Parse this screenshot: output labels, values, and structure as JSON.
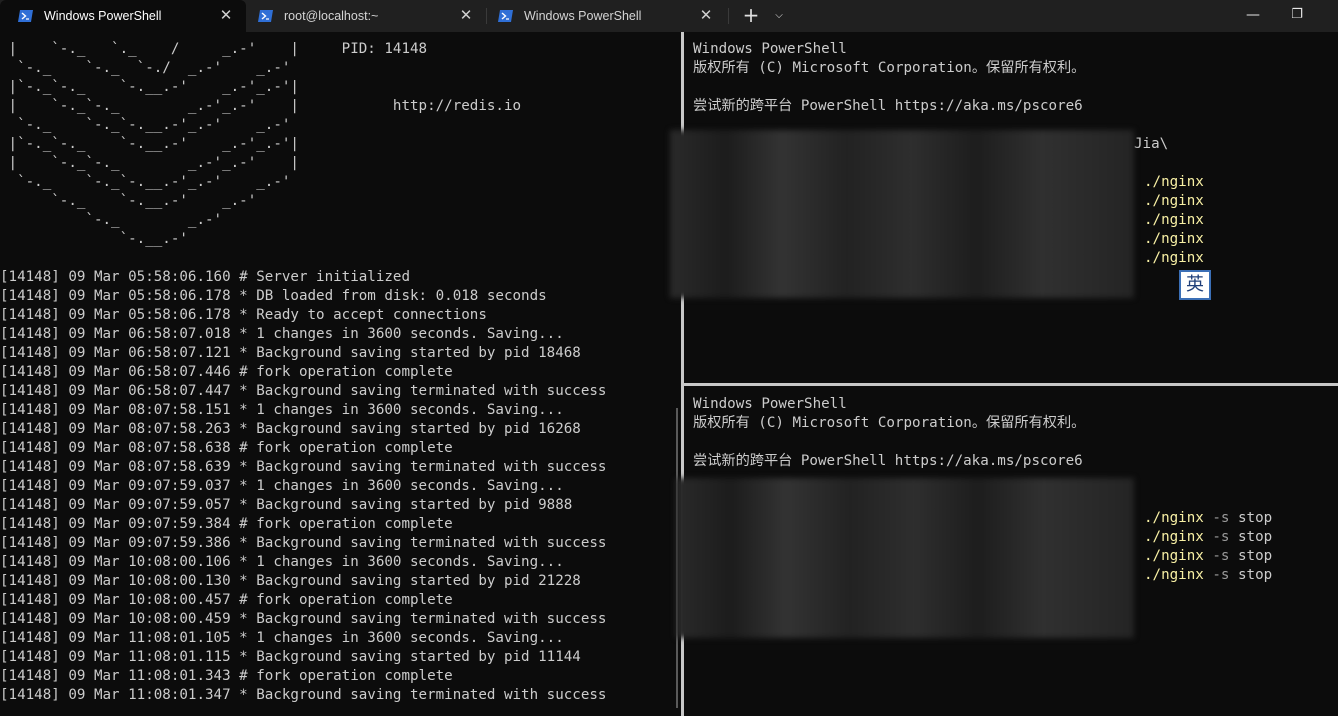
{
  "tabs": [
    {
      "title": "Windows PowerShell",
      "close": "✕",
      "active": true,
      "icon": "powershell-icon"
    },
    {
      "title": "root@localhost:~",
      "close": "✕",
      "active": false,
      "icon": "terminal-icon"
    },
    {
      "title": "Windows PowerShell",
      "close": "✕",
      "active": false,
      "icon": "powershell-icon"
    }
  ],
  "controls": {
    "new_tab": "+",
    "dropdown": "⌵",
    "minimize": "—",
    "maximize": "❐"
  },
  "colors": {
    "accent": "#f9f1a5",
    "background": "#0c0c0c",
    "text": "#cccccc",
    "tabbar": "#202020",
    "ime_border": "#3b6fb6"
  },
  "left_pane": {
    "lines": [
      " |    `-._   `._    /     _.-'    |     PID: 14148",
      "  `-._    `-._  `-./  _.-'    _.-'",
      " |`-._`-._    `-.__.-'    _.-'_.-'|",
      " |    `-._`-._        _.-'_.-'    |           http://redis.io",
      "  `-._    `-._`-.__.-'_.-'    _.-'",
      " |`-._`-._    `-.__.-'    _.-'_.-'|",
      " |    `-._`-._        _.-'_.-'    |",
      "  `-._    `-._`-.__.-'_.-'    _.-'",
      "      `-._    `-.__.-'    _.-'",
      "          `-._        _.-'",
      "              `-.__.-'",
      "",
      "[14148] 09 Mar 05:58:06.160 # Server initialized",
      "[14148] 09 Mar 05:58:06.178 * DB loaded from disk: 0.018 seconds",
      "[14148] 09 Mar 05:58:06.178 * Ready to accept connections",
      "[14148] 09 Mar 06:58:07.018 * 1 changes in 3600 seconds. Saving...",
      "[14148] 09 Mar 06:58:07.121 * Background saving started by pid 18468",
      "[14148] 09 Mar 06:58:07.446 # fork operation complete",
      "[14148] 09 Mar 06:58:07.447 * Background saving terminated with success",
      "[14148] 09 Mar 08:07:58.151 * 1 changes in 3600 seconds. Saving...",
      "[14148] 09 Mar 08:07:58.263 * Background saving started by pid 16268",
      "[14148] 09 Mar 08:07:58.638 # fork operation complete",
      "[14148] 09 Mar 08:07:58.639 * Background saving terminated with success",
      "[14148] 09 Mar 09:07:59.037 * 1 changes in 3600 seconds. Saving...",
      "[14148] 09 Mar 09:07:59.057 * Background saving started by pid 9888",
      "[14148] 09 Mar 09:07:59.384 # fork operation complete",
      "[14148] 09 Mar 09:07:59.386 * Background saving terminated with success",
      "[14148] 09 Mar 10:08:00.106 * 1 changes in 3600 seconds. Saving...",
      "[14148] 09 Mar 10:08:00.130 * Background saving started by pid 21228",
      "[14148] 09 Mar 10:08:00.457 # fork operation complete",
      "[14148] 09 Mar 10:08:00.459 * Background saving terminated with success",
      "[14148] 09 Mar 11:08:01.105 * 1 changes in 3600 seconds. Saving...",
      "[14148] 09 Mar 11:08:01.115 * Background saving started by pid 11144",
      "[14148] 09 Mar 11:08:01.343 # fork operation complete",
      "[14148] 09 Mar 11:08:01.347 * Background saving terminated with success"
    ]
  },
  "top_right_pane": {
    "header": [
      "Windows PowerShell",
      "版权所有 (C) Microsoft Corporation。保留所有权利。",
      "",
      "尝试新的跨平台 PowerShell https://aka.ms/pscore6"
    ],
    "path_suffix": "Jia\\",
    "commands": [
      "./nginx",
      "./nginx",
      "./nginx",
      "./nginx",
      "./nginx"
    ]
  },
  "bottom_right_pane": {
    "header": [
      "Windows PowerShell",
      "版权所有 (C) Microsoft Corporation。保留所有权利。",
      "",
      "尝试新的跨平台 PowerShell https://aka.ms/pscore6"
    ],
    "commands": [
      {
        "cmd": "./nginx",
        "flag": "-s",
        "arg": "stop"
      },
      {
        "cmd": "./nginx",
        "flag": "-s",
        "arg": "stop"
      },
      {
        "cmd": "./nginx",
        "flag": "-s",
        "arg": "stop"
      },
      {
        "cmd": "./nginx",
        "flag": "-s",
        "arg": "stop"
      }
    ]
  },
  "ime": {
    "label": "英"
  }
}
